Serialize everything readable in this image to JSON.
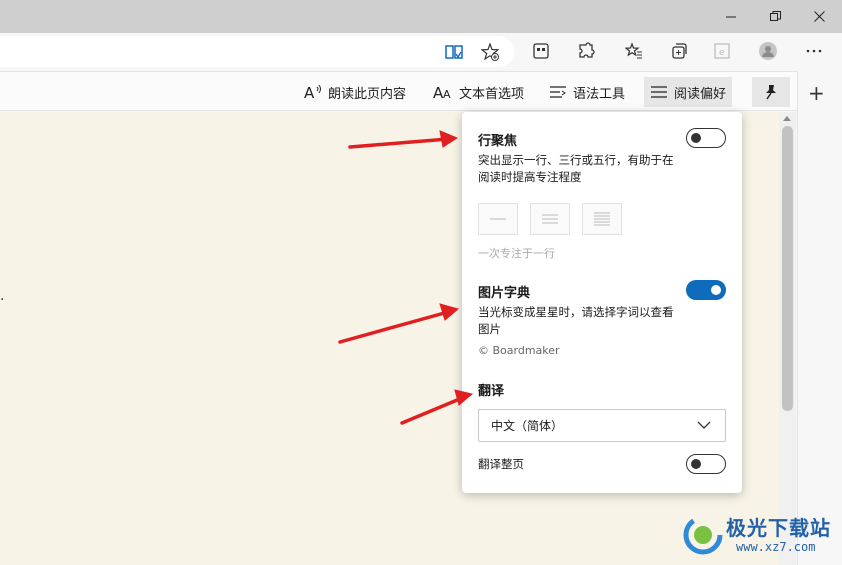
{
  "window": {
    "minimize_icon": "minimize-icon",
    "maximize_icon": "restore-icon",
    "close_icon": "close-icon"
  },
  "toolbar": {
    "icons": [
      "immersive-reader-icon",
      "add-favorite-icon",
      "app-icon",
      "extensions-icon",
      "favorites-icon",
      "collections-icon",
      "internet-explorer-icon",
      "profile-icon",
      "more-icon"
    ]
  },
  "reader_bar": {
    "read_aloud": "朗读此页内容",
    "text_prefs": "文本首选项",
    "grammar": "语法工具",
    "reading_prefs": "阅读偏好",
    "pin_icon": "pin-icon"
  },
  "panel": {
    "line_focus": {
      "title": "行聚焦",
      "desc": "突出显示一行、三行或五行，有助于在阅读时提高专注程度",
      "enabled": false,
      "hint": "一次专注于一行"
    },
    "picture_dictionary": {
      "title": "图片字典",
      "desc": "当光标变成星星时，请选择字词以查看图片",
      "source": "© Boardmaker",
      "enabled": true
    },
    "translate": {
      "title": "翻译",
      "language": "中文（简体）",
      "translate_page_label": "翻译整页",
      "translate_page_enabled": false
    }
  },
  "page": {
    "partial_text": "."
  },
  "watermark": {
    "title": "极光下载站",
    "url": "www.xz7.com"
  },
  "colors": {
    "accent": "#0f6cbd",
    "page_bg": "#f8f3e7",
    "arrow": "#e02020"
  }
}
